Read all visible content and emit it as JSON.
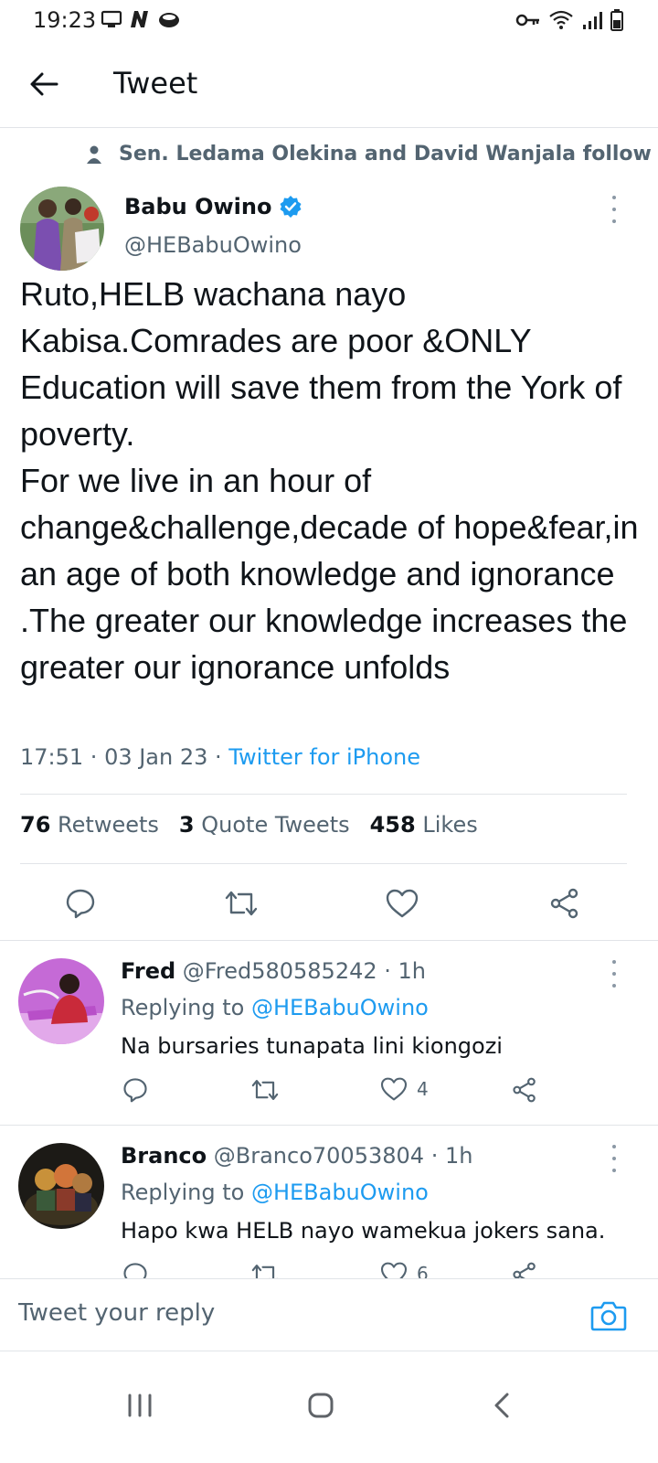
{
  "status_bar": {
    "time": "19:23",
    "left_icons": [
      "screen-icon",
      "n-notification-icon",
      "app-notification-icon"
    ],
    "right_icons": [
      "key-icon",
      "wifi-icon",
      "signal-icon",
      "battery-icon"
    ]
  },
  "header": {
    "title": "Tweet"
  },
  "social_context": "Sen. Ledama Olekina and David Wanjala follow",
  "tweet": {
    "author_name": "Babu Owino",
    "author_handle": "@HEBabuOwino",
    "verified": true,
    "text": "Ruto,HELB wachana nayo Kabisa.Comrades are poor &ONLY Education will save them from the York of poverty.\nFor we live in an hour of change&challenge,decade of hope&fear,in an age of both knowledge and ignorance .The greater our knowledge increases the greater our ignorance unfolds",
    "time": "17:51",
    "date": "03 Jan 23",
    "source": "Twitter for iPhone",
    "sep": " · ",
    "stats": {
      "retweets_count": "76",
      "retweets_label": "Retweets",
      "quotes_count": "3",
      "quotes_label": "Quote Tweets",
      "likes_count": "458",
      "likes_label": "Likes"
    }
  },
  "replies": [
    {
      "name": "Fred",
      "handle": "@Fred580585242",
      "age": " · 1h",
      "replying_prefix": "Replying to ",
      "replying_to": "@HEBabuOwino",
      "text": "Na bursaries tunapata lini kiongozi",
      "likes": "4"
    },
    {
      "name": "Branco",
      "handle": "@Branco70053804",
      "age": " · 1h",
      "replying_prefix": "Replying to ",
      "replying_to": "@HEBabuOwino",
      "text": "Hapo kwa HELB nayo wamekua jokers sana.",
      "likes": "6"
    }
  ],
  "composer": {
    "placeholder": "Tweet your reply"
  },
  "colors": {
    "accent": "#1d9bf0",
    "text": "#0f1419",
    "muted": "#536471"
  }
}
